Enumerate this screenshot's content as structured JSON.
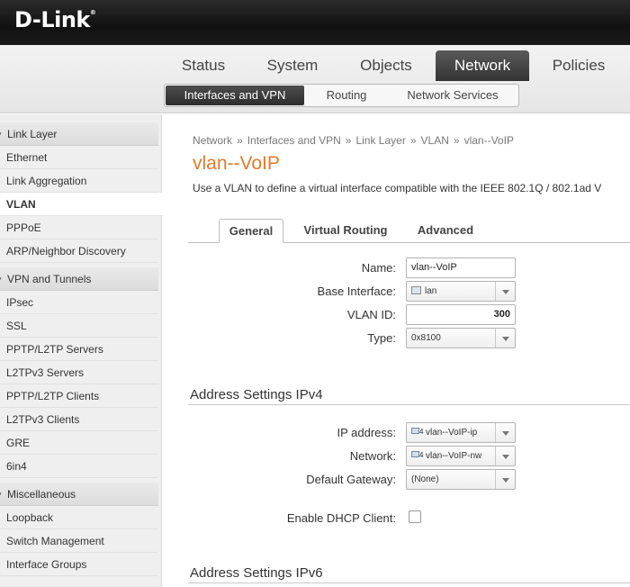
{
  "brand": {
    "logo": "D-Link",
    "logo_mark": "®"
  },
  "main_nav": [
    "Status",
    "System",
    "Objects",
    "Network",
    "Policies"
  ],
  "sub_nav": [
    "Interfaces and VPN",
    "Routing",
    "Network Services"
  ],
  "sidebar": {
    "groups": [
      {
        "title": "Link Layer",
        "items": [
          "Ethernet",
          "Link Aggregation",
          "VLAN",
          "PPPoE",
          "ARP/Neighbor Discovery"
        ]
      },
      {
        "title": "VPN and Tunnels",
        "items": [
          "IPsec",
          "SSL",
          "PPTP/L2TP Servers",
          "L2TPv3 Servers",
          "PPTP/L2TP Clients",
          "L2TPv3 Clients",
          "GRE",
          "6in4"
        ]
      },
      {
        "title": "Miscellaneous",
        "items": [
          "Loopback",
          "Switch Management",
          "Interface Groups"
        ]
      }
    ],
    "active_item": "VLAN"
  },
  "breadcrumb": [
    "Network",
    "Interfaces and VPN",
    "Link Layer",
    "VLAN",
    "vlan--VoIP"
  ],
  "breadcrumb_sep": "»",
  "page": {
    "title": "vlan--VoIP",
    "description": "Use a VLAN to define a virtual interface compatible with the IEEE 802.1Q / 802.1ad V"
  },
  "content_tabs": [
    "General",
    "Virtual Routing",
    "Advanced"
  ],
  "general": {
    "name_label": "Name:",
    "name_value": "vlan--VoIP",
    "base_interface_label": "Base Interface:",
    "base_interface_value": "lan",
    "vlan_id_label": "VLAN ID:",
    "vlan_id_value": "300",
    "type_label": "Type:",
    "type_value": "0x8100"
  },
  "ipv4": {
    "section_title": "Address Settings IPv4",
    "ip_label": "IP address:",
    "ip_value": "vlan--VoIP-ip",
    "network_label": "Network:",
    "network_value": "vlan--VoIP-nw",
    "gateway_label": "Default Gateway:",
    "gateway_value": "(None)",
    "dhcp_label": "Enable DHCP Client:",
    "dhcp_checked": false,
    "icon_text": "4"
  },
  "ipv6": {
    "section_title": "Address Settings IPv6"
  },
  "colors": {
    "title_orange": "#e07a2e",
    "active_tab": "#333333"
  }
}
